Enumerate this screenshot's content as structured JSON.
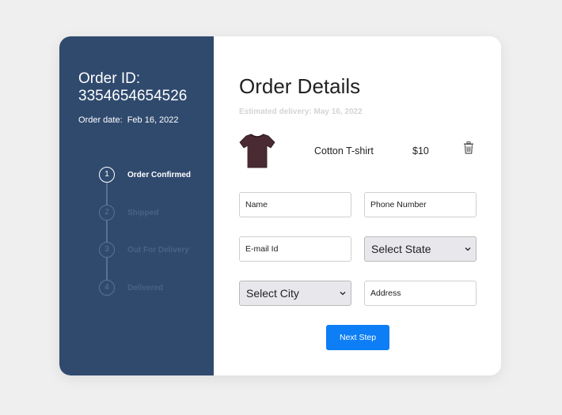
{
  "order": {
    "id_label": "Order ID:",
    "id_value": "3354654654526",
    "date_label": "Order date:",
    "date_value": "Feb 16, 2022"
  },
  "steps": [
    {
      "number": "1",
      "label": "Order Confirmed",
      "active": true
    },
    {
      "number": "2",
      "label": "Shipped",
      "active": false
    },
    {
      "number": "3",
      "label": "Out For Delivery",
      "active": false
    },
    {
      "number": "4",
      "label": "Delivered",
      "active": false
    }
  ],
  "details": {
    "title": "Order Details",
    "estimated_delivery": "Estimated delivery: May 16, 2022"
  },
  "product": {
    "name": "Cotton T-shirt",
    "price": "$10",
    "image_icon": "tshirt-icon",
    "delete_icon": "trash-icon"
  },
  "form": {
    "name_placeholder": "Name",
    "phone_placeholder": "Phone Number",
    "email_placeholder": "E-mail Id",
    "state_selected": "Select State",
    "city_selected": "Select City",
    "address_placeholder": "Address"
  },
  "actions": {
    "next_label": "Next Step"
  },
  "colors": {
    "sidebar_bg": "#304a6e",
    "primary_button": "#0d7ef5",
    "page_bg": "#efefef"
  }
}
